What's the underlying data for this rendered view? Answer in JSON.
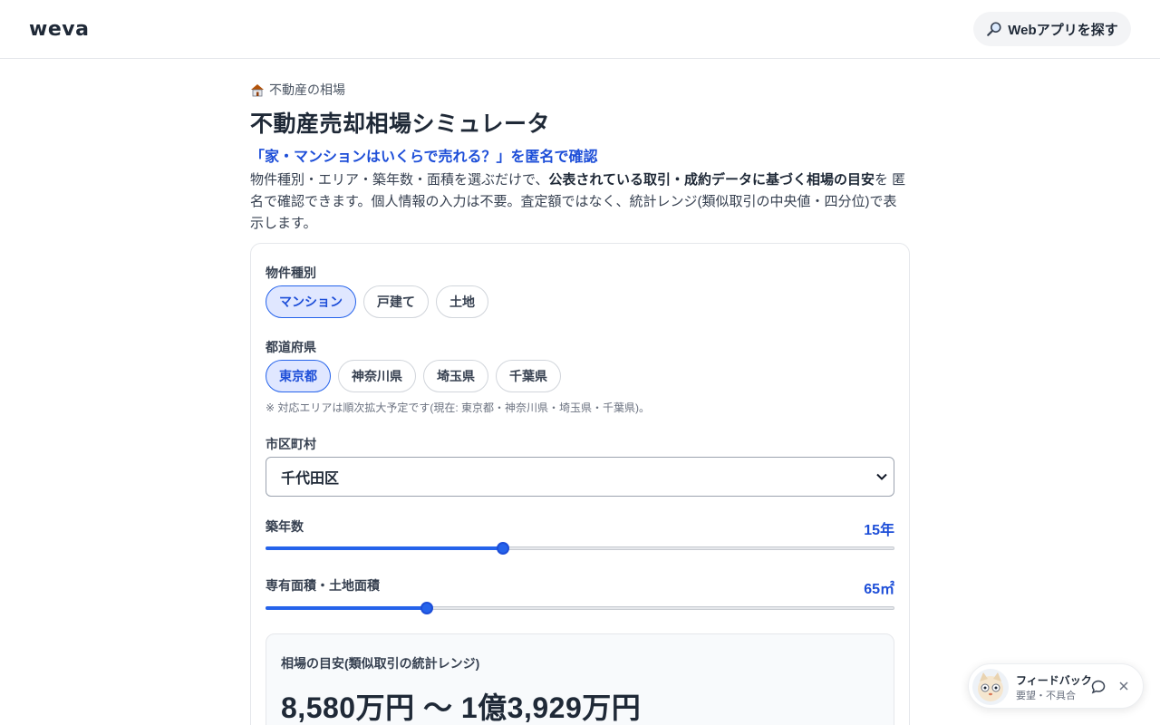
{
  "header": {
    "logo": "weva",
    "find_apps_label": "Webアプリを探す"
  },
  "page": {
    "breadcrumb": "不動産の相場",
    "title": "不動産売却相場シミュレータ",
    "subtitle": "「家・マンションはいくらで売れる？」を匿名で確認",
    "desc_part1": "物件種別・エリア・築年数・面積を選ぶだけで、",
    "desc_bold": "公表されている取引・成約データに基づく相場の目安",
    "desc_part2": "を 匿名で確認できます。個人情報の入力は不要。査定額ではなく、統計レンジ(類似取引の中央値・四分位)で表示します。"
  },
  "form": {
    "property_type": {
      "label": "物件種別",
      "options": [
        "マンション",
        "戸建て",
        "土地"
      ],
      "selected": "マンション"
    },
    "prefecture": {
      "label": "都道府県",
      "options": [
        "東京都",
        "神奈川県",
        "埼玉県",
        "千葉県"
      ],
      "selected": "東京都",
      "note": "※ 対応エリアは順次拡大予定です(現在: 東京都・神奈川県・埼玉県・千葉県)。"
    },
    "city": {
      "label": "市区町村",
      "value": "千代田区"
    },
    "age": {
      "label": "築年数",
      "value_text": "15年",
      "fraction": 0.378
    },
    "area": {
      "label": "専有面積・土地面積",
      "value_text": "65㎡",
      "fraction": 0.256
    }
  },
  "result": {
    "label": "相場の目安(類似取引の統計レンジ)",
    "value": "8,580万円 〜 1億3,929万円"
  },
  "feedback": {
    "title": "フィードバック",
    "subtitle": "要望・不具合"
  },
  "colors": {
    "accent": "#2563eb",
    "accent_dark": "#1d4ed8",
    "chip_active_bg": "#e0e7ff"
  }
}
